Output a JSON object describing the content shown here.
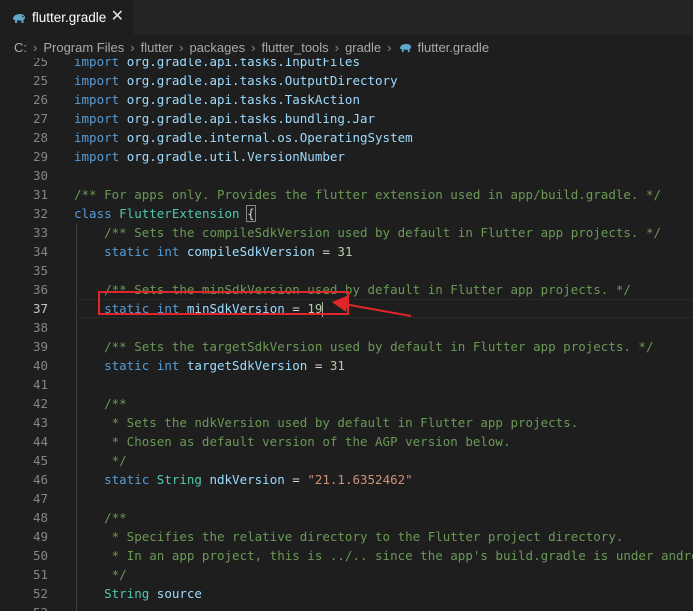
{
  "tab": {
    "title": "flutter.gradle",
    "close_glyph": "✕",
    "icon": "gradle-elephant-icon"
  },
  "breadcrumb": [
    "C:",
    "Program Files",
    "flutter",
    "packages",
    "flutter_tools",
    "gradle",
    "flutter.gradle"
  ],
  "colors": {
    "keyword": "#569cd6",
    "type": "#4ec9b0",
    "ident": "#9cdcfe",
    "comment": "#6a9955",
    "string": "#ce9178",
    "number": "#b5cea8",
    "text": "#d4d4d4",
    "annotation": "#e0252b"
  },
  "editor": {
    "active_line": 37,
    "lines": [
      {
        "n": 25,
        "tokens": [
          {
            "t": "import ",
            "c": "keyword"
          },
          {
            "t": "org.gradle.api.tasks.InputFiles",
            "c": "ident"
          }
        ]
      },
      {
        "n": 25,
        "tokens": [
          {
            "t": "import ",
            "c": "keyword"
          },
          {
            "t": "org.gradle.api.tasks.OutputDirectory",
            "c": "ident"
          }
        ]
      },
      {
        "n": 26,
        "tokens": [
          {
            "t": "import ",
            "c": "keyword"
          },
          {
            "t": "org.gradle.api.tasks.TaskAction",
            "c": "ident"
          }
        ]
      },
      {
        "n": 27,
        "tokens": [
          {
            "t": "import ",
            "c": "keyword"
          },
          {
            "t": "org.gradle.api.tasks.bundling.Jar",
            "c": "ident"
          }
        ]
      },
      {
        "n": 28,
        "tokens": [
          {
            "t": "import ",
            "c": "keyword"
          },
          {
            "t": "org.gradle.internal.os.OperatingSystem",
            "c": "ident"
          }
        ]
      },
      {
        "n": 29,
        "tokens": [
          {
            "t": "import ",
            "c": "keyword"
          },
          {
            "t": "org.gradle.util.VersionNumber",
            "c": "ident"
          }
        ]
      },
      {
        "n": 30,
        "tokens": []
      },
      {
        "n": 31,
        "tokens": [
          {
            "t": "/** For apps only. Provides the flutter extension used in app/build.gradle. */",
            "c": "comment"
          }
        ]
      },
      {
        "n": 32,
        "tokens": [
          {
            "t": "class ",
            "c": "keyword"
          },
          {
            "t": "FlutterExtension ",
            "c": "type"
          },
          {
            "t": "{",
            "c": "text",
            "bracket": true
          }
        ]
      },
      {
        "n": 33,
        "tokens": [
          {
            "t": "    /** Sets the compileSdkVersion used by default in Flutter app projects. */",
            "c": "comment"
          }
        ]
      },
      {
        "n": 34,
        "tokens": [
          {
            "t": "    static ",
            "c": "keyword"
          },
          {
            "t": "int ",
            "c": "keyword"
          },
          {
            "t": "compileSdkVersion",
            "c": "ident"
          },
          {
            "t": " = ",
            "c": "text"
          },
          {
            "t": "31",
            "c": "number"
          }
        ]
      },
      {
        "n": 35,
        "tokens": []
      },
      {
        "n": 36,
        "tokens": [
          {
            "t": "    /** Sets the minSdkVersion used by default in Flutter app projects. */",
            "c": "comment"
          }
        ]
      },
      {
        "n": 37,
        "tokens": [
          {
            "t": "    static ",
            "c": "keyword"
          },
          {
            "t": "int ",
            "c": "keyword"
          },
          {
            "t": "minSdkVersion",
            "c": "ident"
          },
          {
            "t": " = ",
            "c": "text"
          },
          {
            "t": "19",
            "c": "number"
          }
        ],
        "caret": true
      },
      {
        "n": 38,
        "tokens": []
      },
      {
        "n": 39,
        "tokens": [
          {
            "t": "    /** Sets the targetSdkVersion used by default in Flutter app projects. */",
            "c": "comment"
          }
        ]
      },
      {
        "n": 40,
        "tokens": [
          {
            "t": "    static ",
            "c": "keyword"
          },
          {
            "t": "int ",
            "c": "keyword"
          },
          {
            "t": "targetSdkVersion",
            "c": "ident"
          },
          {
            "t": " = ",
            "c": "text"
          },
          {
            "t": "31",
            "c": "number"
          }
        ]
      },
      {
        "n": 41,
        "tokens": []
      },
      {
        "n": 42,
        "tokens": [
          {
            "t": "    /**",
            "c": "comment"
          }
        ]
      },
      {
        "n": 43,
        "tokens": [
          {
            "t": "     * Sets the ndkVersion used by default in Flutter app projects.",
            "c": "comment"
          }
        ]
      },
      {
        "n": 44,
        "tokens": [
          {
            "t": "     * Chosen as default version of the AGP version below.",
            "c": "comment"
          }
        ]
      },
      {
        "n": 45,
        "tokens": [
          {
            "t": "     */",
            "c": "comment"
          }
        ]
      },
      {
        "n": 46,
        "tokens": [
          {
            "t": "    static ",
            "c": "keyword"
          },
          {
            "t": "String ",
            "c": "type"
          },
          {
            "t": "ndkVersion",
            "c": "ident"
          },
          {
            "t": " = ",
            "c": "text"
          },
          {
            "t": "\"21.1.6352462\"",
            "c": "string"
          }
        ]
      },
      {
        "n": 47,
        "tokens": []
      },
      {
        "n": 48,
        "tokens": [
          {
            "t": "    /**",
            "c": "comment"
          }
        ]
      },
      {
        "n": 49,
        "tokens": [
          {
            "t": "     * Specifies the relative directory to the Flutter project directory.",
            "c": "comment"
          }
        ]
      },
      {
        "n": 50,
        "tokens": [
          {
            "t": "     * In an app project, this is ../.. since the app's build.gradle is under android/app.",
            "c": "comment"
          }
        ]
      },
      {
        "n": 51,
        "tokens": [
          {
            "t": "     */",
            "c": "comment"
          }
        ]
      },
      {
        "n": 52,
        "tokens": [
          {
            "t": "    String ",
            "c": "type"
          },
          {
            "t": "source",
            "c": "ident"
          }
        ]
      },
      {
        "n": 53,
        "tokens": []
      }
    ]
  }
}
